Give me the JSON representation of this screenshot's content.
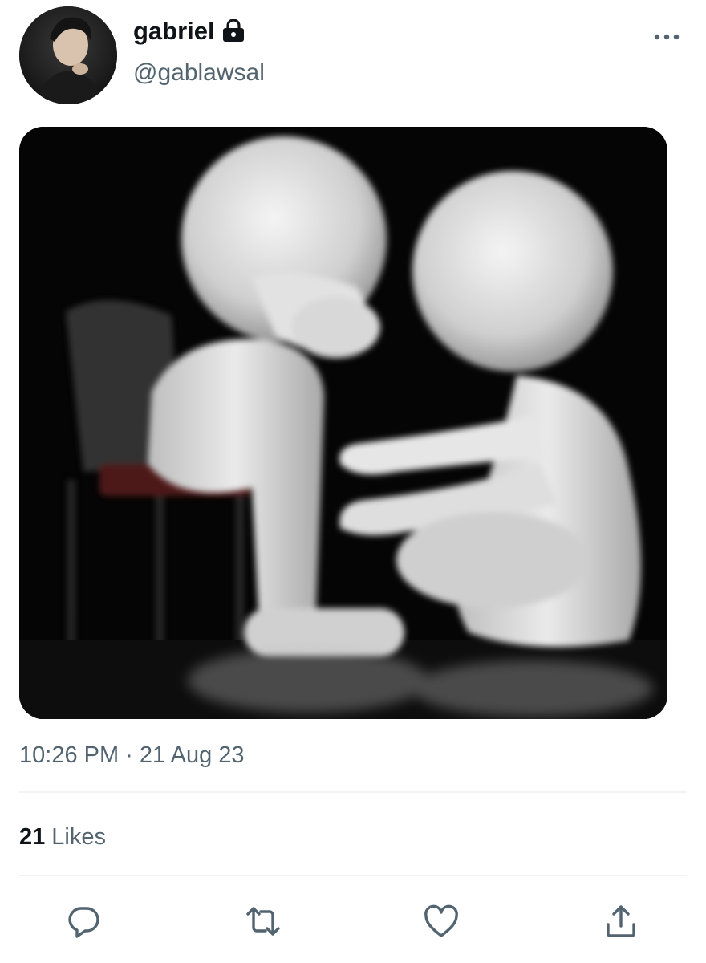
{
  "tweet": {
    "display_name": "gabriel",
    "handle": "@gablawsal",
    "protected_icon": "lock-icon",
    "more_icon": "more-options-icon",
    "timestamp": "10:26 PM · 21 Aug 23",
    "likes_count": "21",
    "likes_label": "Likes"
  },
  "actions": [
    {
      "name": "reply-button",
      "icon": "reply-icon"
    },
    {
      "name": "retweet-button",
      "icon": "retweet-icon"
    },
    {
      "name": "like-button",
      "icon": "heart-icon"
    },
    {
      "name": "share-button",
      "icon": "share-icon"
    }
  ],
  "colors": {
    "text_primary": "#0f1419",
    "text_secondary": "#536471",
    "divider": "#eff3f4",
    "icon": "#536471"
  }
}
